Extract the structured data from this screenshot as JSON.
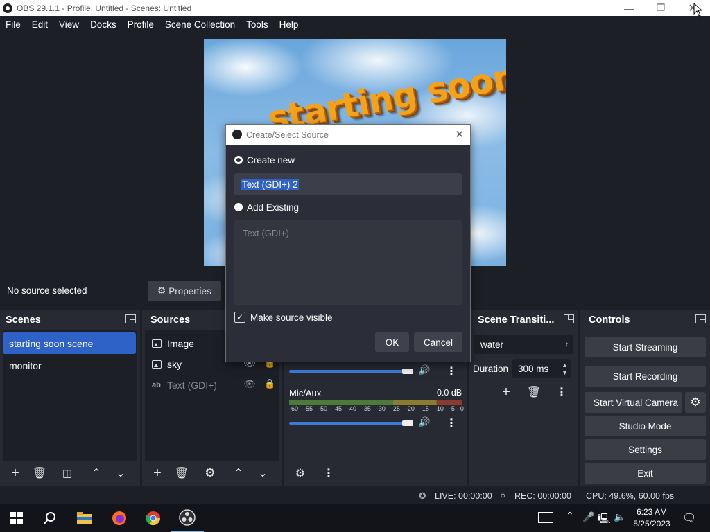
{
  "window": {
    "title": "OBS 29.1.1 - Profile: Untitled - Scenes: Untitled"
  },
  "menu": [
    "File",
    "Edit",
    "View",
    "Docks",
    "Profile",
    "Scene Collection",
    "Tools",
    "Help"
  ],
  "preview": {
    "overlay_text": "starting soon"
  },
  "status_under_preview": {
    "no_source": "No source selected",
    "properties_label": "Properties"
  },
  "scenes": {
    "title": "Scenes",
    "items": [
      "starting soon scene",
      "monitor"
    ]
  },
  "sources": {
    "title": "Sources",
    "items": [
      "Image",
      "sky",
      "Text (GDI+)"
    ]
  },
  "mixer": {
    "mic_label": "Mic/Aux",
    "mic_db": "0.0 dB",
    "scale": [
      "-60",
      "-55",
      "-50",
      "-45",
      "-40",
      "-35",
      "-30",
      "-25",
      "-20",
      "-15",
      "-10",
      "-5",
      "0"
    ]
  },
  "transitions": {
    "title": "Scene Transiti...",
    "selected": "water",
    "duration_label": "Duration",
    "duration_value": "300 ms"
  },
  "controls": {
    "title": "Controls",
    "start_streaming": "Start Streaming",
    "start_recording": "Start Recording",
    "start_virtual_camera": "Start Virtual Camera",
    "studio_mode": "Studio Mode",
    "settings": "Settings",
    "exit": "Exit"
  },
  "statusbar": {
    "live": "LIVE: 00:00:00",
    "rec": "REC: 00:00:00",
    "cpu": "CPU: 49.6%, 60.00 fps"
  },
  "taskbar": {
    "time": "6:23 AM",
    "date": "5/25/2023"
  },
  "dialog": {
    "title": "Create/Select Source",
    "create_new_label": "Create new",
    "new_name_value": "Text (GDI+) 2",
    "add_existing_label": "Add Existing",
    "existing_items": [
      "Text (GDI+)"
    ],
    "make_visible_label": "Make source visible",
    "make_visible_checked": true,
    "ok_label": "OK",
    "cancel_label": "Cancel"
  }
}
